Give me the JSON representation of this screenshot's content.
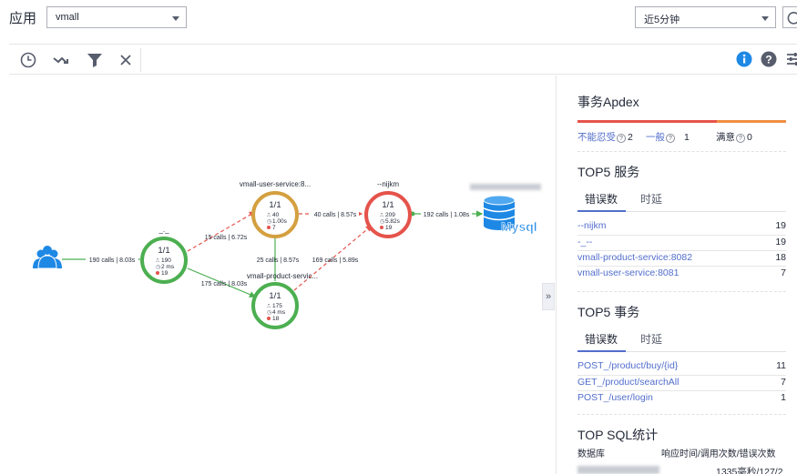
{
  "header": {
    "app_label": "应用",
    "app_selected": "vmall",
    "time_selected": "近5分钟"
  },
  "toolbar": {
    "icons": [
      "clock-icon",
      "trend-icon",
      "filter-icon",
      "close-icon"
    ],
    "right_icons": [
      "info-icon",
      "help-icon",
      "settings-icon"
    ]
  },
  "topology": {
    "nodes": [
      {
        "id": "users",
        "kind": "users"
      },
      {
        "id": "entry",
        "name": "_._",
        "ratio": "1/1",
        "calls": "190",
        "rt": "2 ms",
        "errors": "19",
        "color": "#4caf50"
      },
      {
        "id": "user-svc",
        "name": "vmall-user-service:8...",
        "ratio": "1/1",
        "calls": "40",
        "rt": "1.00s",
        "errors": "7",
        "color": "#d4a040"
      },
      {
        "id": "product-svc",
        "name": "vmall-product-servic...",
        "ratio": "1/1",
        "calls": "175",
        "rt": "4 ms",
        "errors": "18",
        "color": "#4caf50"
      },
      {
        "id": "nijkm",
        "name": "--nijkm",
        "ratio": "1/1",
        "calls": "209",
        "rt": "5.82s",
        "errors": "19",
        "color": "#e5534b"
      },
      {
        "id": "mysql",
        "kind": "db",
        "label": "Mysql"
      }
    ],
    "edges": {
      "users_entry": "190 calls | 8.03s",
      "entry_user": "15 calls | 6.72s",
      "entry_product": "175 calls | 8.03s",
      "product_user": "25 calls | 8.57s",
      "user_nijkm": "40 calls | 8.57s",
      "product_nijkm": "169 calls | 5.89s",
      "nijkm_mysql": "192 calls | 1.08s"
    }
  },
  "panel": {
    "apdex": {
      "title": "事务Apdex",
      "frustrated_label": "不能忍受",
      "frustrated": "2",
      "tolerating_label": "一般",
      "tolerating": "1",
      "satisfied_label": "满意",
      "satisfied": "0",
      "frustrated_fraction": 0.667,
      "colors": {
        "frustrated": "#e5534b",
        "tolerating": "#f08e43"
      }
    },
    "top_services": {
      "title": "TOP5 服务",
      "tabs": [
        "错误数",
        "时延"
      ],
      "rows": [
        {
          "name": "--nijkm",
          "count": "19"
        },
        {
          "name": "-_--",
          "count": "19"
        },
        {
          "name": "vmall-product-service:8082",
          "count": "18"
        },
        {
          "name": "vmall-user-service:8081",
          "count": "7"
        }
      ]
    },
    "top_transactions": {
      "title": "TOP5 事务",
      "tabs": [
        "错误数",
        "时延"
      ],
      "rows": [
        {
          "name": "POST_/product/buy/{id}",
          "count": "11"
        },
        {
          "name": "GET_/product/searchAll",
          "count": "7"
        },
        {
          "name": "POST_/user/login",
          "count": "1"
        }
      ]
    },
    "top_sql": {
      "title": "TOP SQL统计",
      "col_db": "数据库",
      "col_stats": "响应时间/调用次数/错误次数",
      "row_value": "1335毫秒/127/2"
    }
  },
  "accent": "#526ecc"
}
